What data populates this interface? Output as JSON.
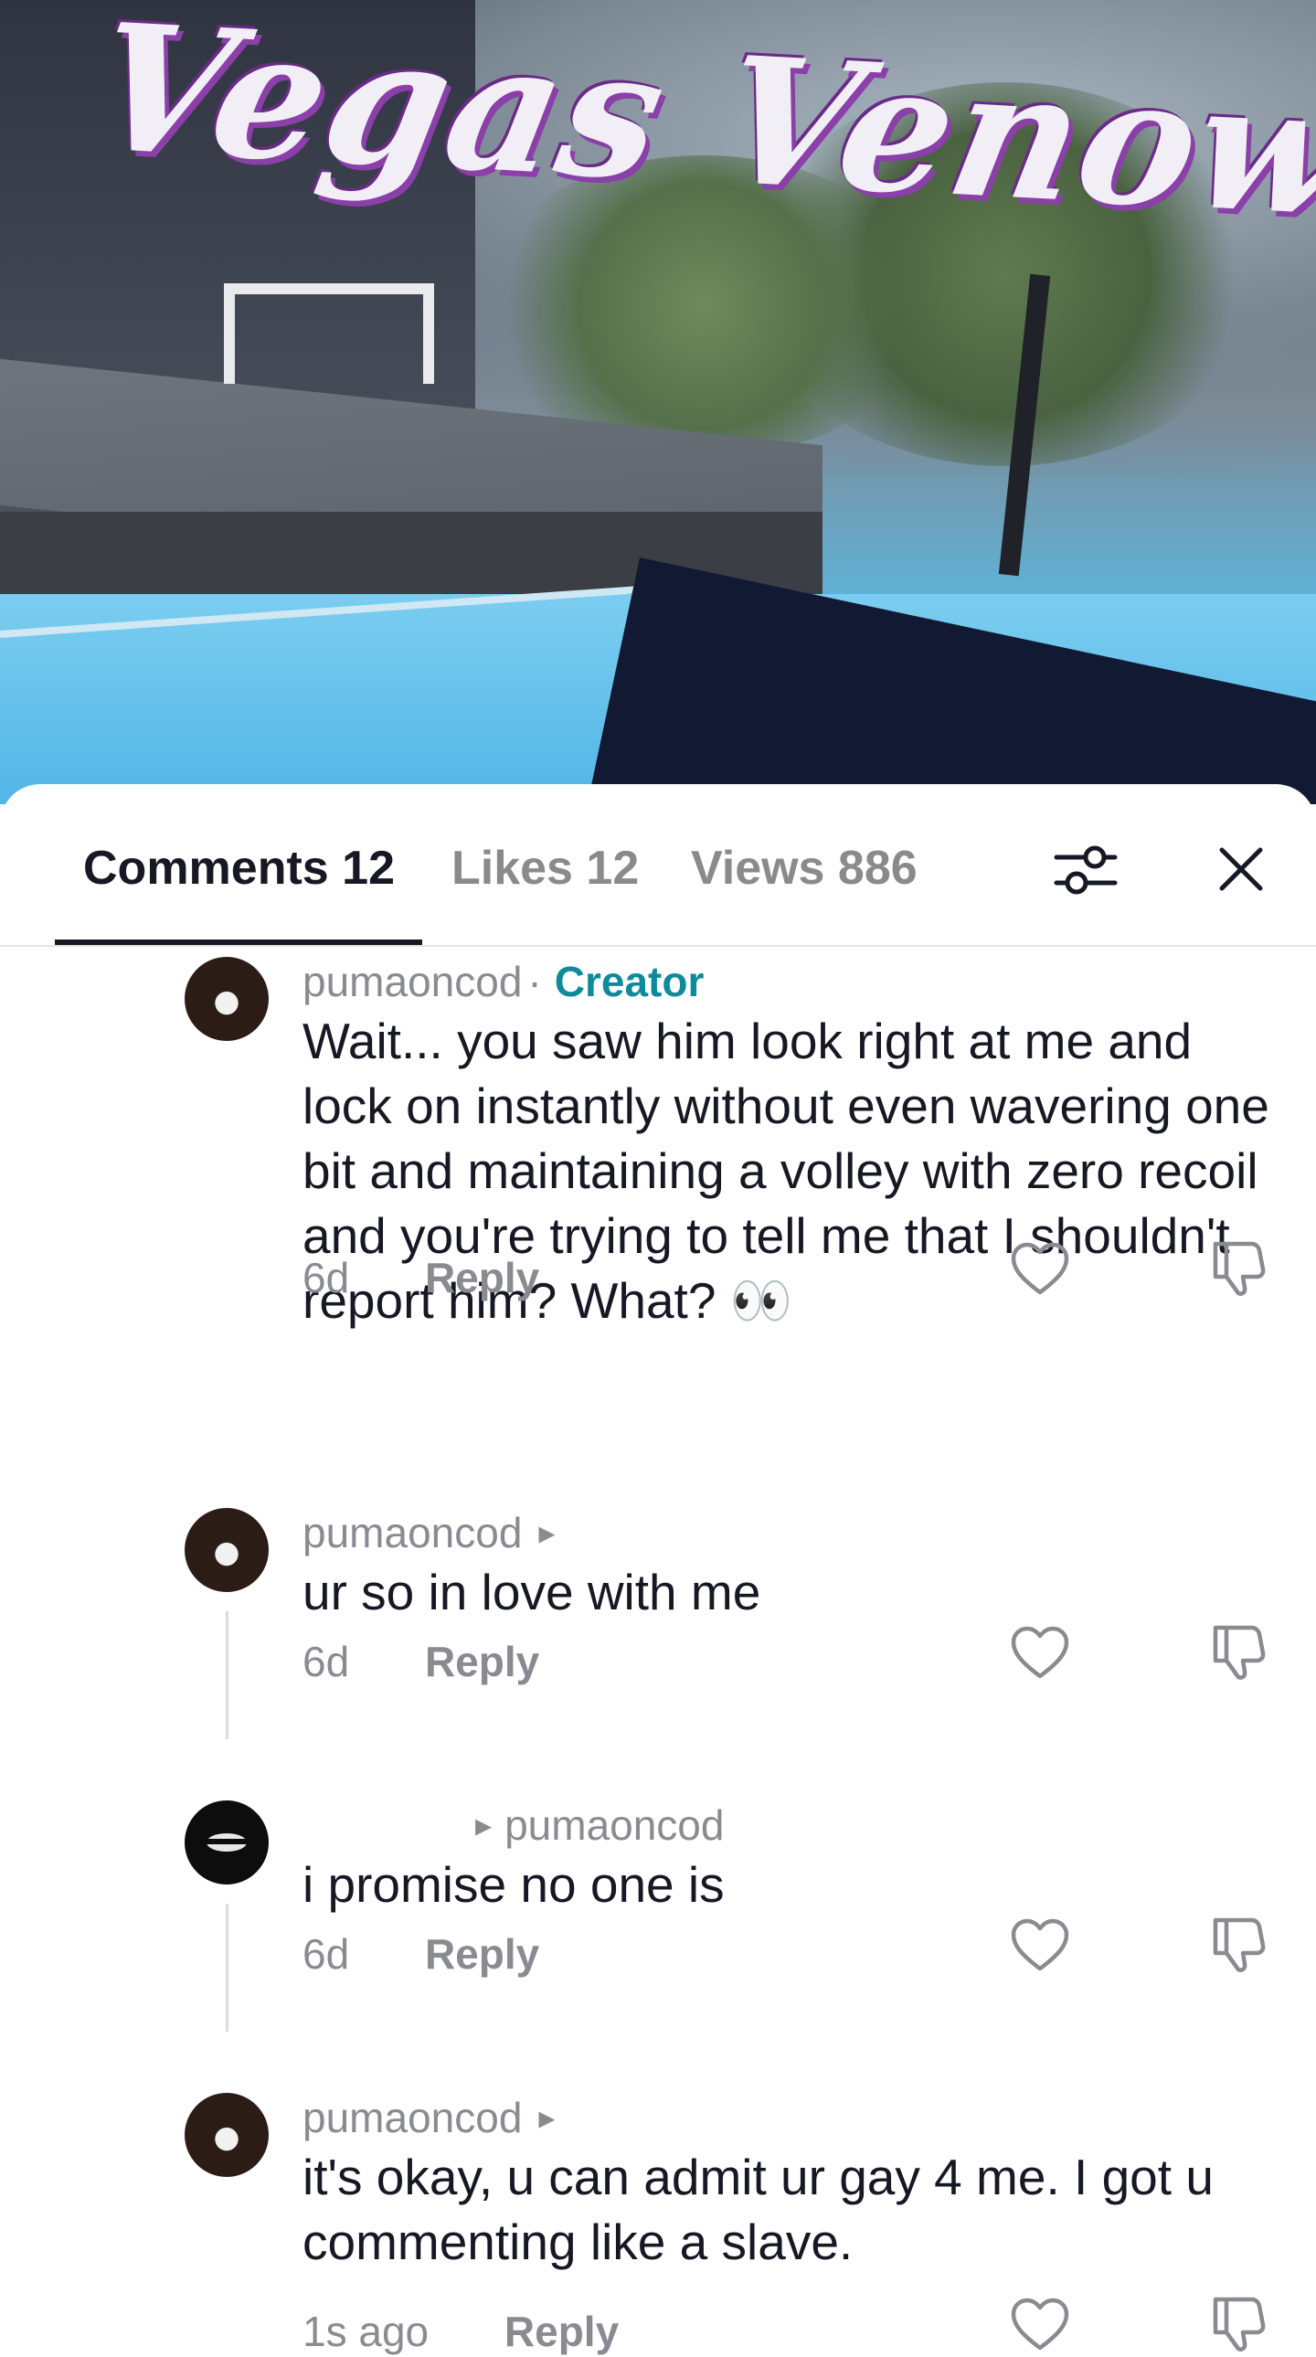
{
  "video": {
    "overlay_title": "Vegas Venow"
  },
  "tabs": [
    {
      "label": "Comments 12"
    },
    {
      "label": "Likes 12"
    },
    {
      "label": "Views 886"
    }
  ],
  "icons": {
    "filter": "sliders-icon",
    "close": "close-icon"
  },
  "comments": [
    {
      "username": "pumaoncod",
      "creator_badge": "Creator",
      "separator": "·",
      "text": "Wait... you saw him look right at me and lock on instantly without even wavering one bit and maintaining a volley with zero recoil and you're trying to tell me that I shouldn't report him? What? 👀",
      "time": "6d",
      "reply": "Reply"
    },
    {
      "username": "pumaoncod",
      "arrow": "▸",
      "text": "ur so in love with me",
      "time": "6d",
      "reply": "Reply"
    },
    {
      "username": "",
      "arrow": "▸",
      "reply_to": "pumaoncod",
      "text": "i promise no one is",
      "time": "6d",
      "reply": "Reply"
    },
    {
      "username": "pumaoncod",
      "arrow": "▸",
      "text": "it's okay, u can admit ur gay 4 me. I got u commenting like a slave.",
      "time": "1s ago",
      "reply": "Reply"
    }
  ]
}
